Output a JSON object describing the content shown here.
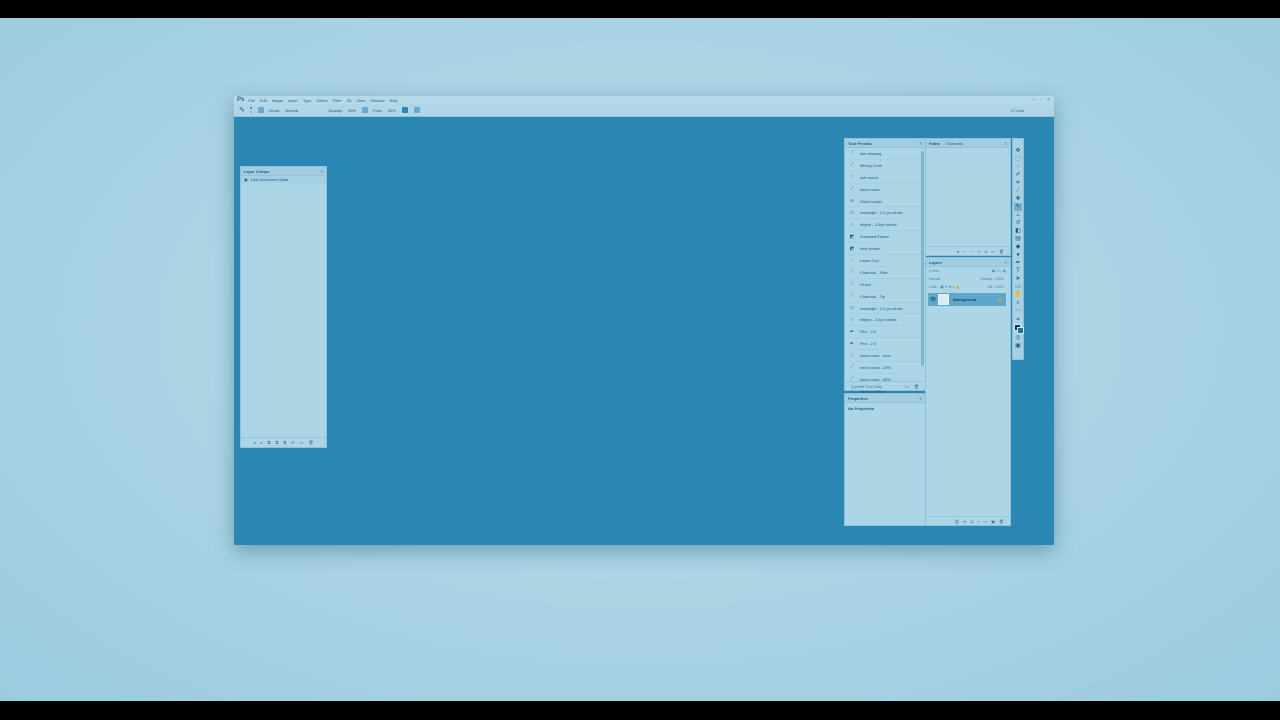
{
  "app": {
    "logo": "Ps",
    "menu": [
      "File",
      "Edit",
      "Image",
      "Layer",
      "Type",
      "Select",
      "Filter",
      "3D",
      "View",
      "Window",
      "Help"
    ],
    "window_buttons": [
      "–",
      "▫",
      "×"
    ]
  },
  "options_bar": {
    "brush_size": "2",
    "mode_label": "Mode:",
    "mode_value": "Normal",
    "opacity_label": "Opacity:",
    "opacity_value": "99%",
    "flow_label": "Flow:",
    "flow_value": "30%",
    "workspace": "27 inch"
  },
  "layer_comps": {
    "title": "Layer Comps",
    "item": "Last Document State",
    "footer_icons": [
      "◂",
      "▸",
      "⧉",
      "⧉",
      "⧉",
      "⟳",
      "▭",
      "🗑"
    ]
  },
  "tool_presets": {
    "title": "Tool Presets",
    "items": [
      {
        "icon": "brush",
        "label": "line drawing"
      },
      {
        "icon": "brush",
        "label": "Mixing Cloth"
      },
      {
        "icon": "brush",
        "label": "soft round"
      },
      {
        "icon": "brush",
        "label": "hard round"
      },
      {
        "icon": "bucket",
        "label": "Paint bucket"
      },
      {
        "icon": "rect",
        "label": "rectangle - 2.5 px stroke"
      },
      {
        "icon": "ellipse",
        "label": "ellipse - 2.5px stroke"
      },
      {
        "icon": "eraser",
        "label": "Kneaded Eraser"
      },
      {
        "icon": "eraser",
        "label": "vinyl eraser"
      },
      {
        "icon": "lasso",
        "label": "Lasso Tool"
      },
      {
        "icon": "brush",
        "label": "Charcoal - Side"
      },
      {
        "icon": "brush",
        "label": "Pencil"
      },
      {
        "icon": "brush",
        "label": "Charcoal - Tip"
      },
      {
        "icon": "rect",
        "label": "rectangle - 2.5 px stroke"
      },
      {
        "icon": "ellipse",
        "label": "ellipse - 2.5px stroke"
      },
      {
        "icon": "pen",
        "label": "Pen - 2.0"
      },
      {
        "icon": "pen",
        "label": "Pen - 2.5"
      },
      {
        "icon": "brush",
        "label": "hard round - tone"
      },
      {
        "icon": "brush",
        "label": "hard round - 10%"
      },
      {
        "icon": "brush",
        "label": "hard round - 50%"
      },
      {
        "icon": "brush",
        "label": "Technical Pen"
      }
    ],
    "footer_label": "Current Tool Only"
  },
  "properties": {
    "title": "Properties",
    "empty": "No Properties"
  },
  "paths": {
    "tabs": [
      "Paths",
      "Channels"
    ]
  },
  "layers": {
    "title": "Layers",
    "kind_label": "ρ Kind",
    "blend": "Normal",
    "opacity_label": "Opacity:",
    "opacity": "100%",
    "lock_label": "Lock:",
    "fill_label": "Fill:",
    "fill": "100%",
    "layer_name": "Background"
  },
  "colors": {
    "canvas": "#2a86b3",
    "panel": "#acd5e6",
    "backdrop": "#b6dbe9",
    "selection": "#5fa6cb"
  }
}
